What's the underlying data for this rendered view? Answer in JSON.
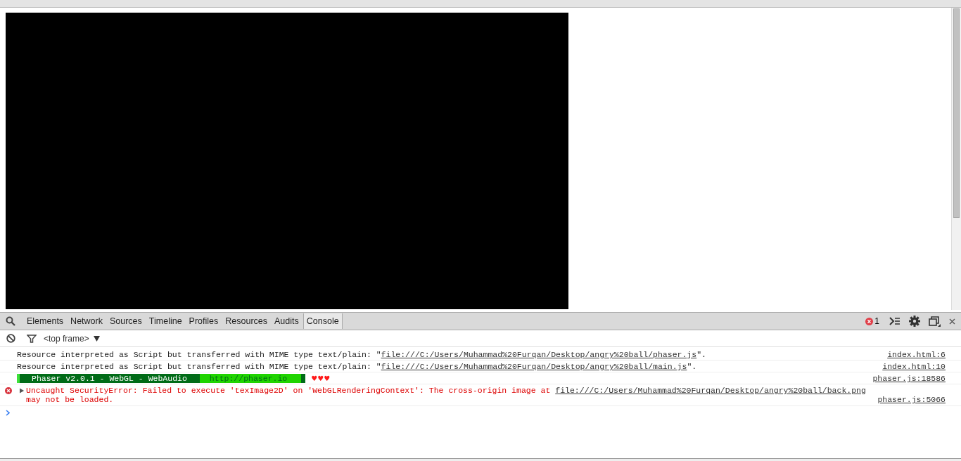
{
  "devtools": {
    "tabs": [
      {
        "label": "Elements",
        "selected": false
      },
      {
        "label": "Network",
        "selected": false
      },
      {
        "label": "Sources",
        "selected": false
      },
      {
        "label": "Timeline",
        "selected": false
      },
      {
        "label": "Profiles",
        "selected": false
      },
      {
        "label": "Resources",
        "selected": false
      },
      {
        "label": "Audits",
        "selected": false
      },
      {
        "label": "Console",
        "selected": true
      }
    ],
    "error_count": "1",
    "frame_selector": "<top frame>"
  },
  "console": {
    "messages": [
      {
        "kind": "log",
        "text": "Resource interpreted as Script but transferred with MIME type text/plain: \"",
        "link": "file:///C:/Users/Muhammad%20Furqan/Desktop/angry%20ball/phaser.js",
        "tail": "\".",
        "source": "index.html:6"
      },
      {
        "kind": "log",
        "text": "Resource interpreted as Script but transferred with MIME type text/plain: \"",
        "link": "file:///C:/Users/Muhammad%20Furqan/Desktop/angry%20ball/main.js",
        "tail": "\".",
        "source": "index.html:10"
      },
      {
        "kind": "banner",
        "title": "Phaser v2.0.1 - WebGL - WebAudio",
        "url": "http://phaser.io",
        "hearts": "♥♥♥",
        "source": "phaser.js:18586"
      },
      {
        "kind": "error",
        "expanded": false,
        "text": "Uncaught SecurityError: Failed to execute 'texImage2D' on 'WebGLRenderingContext': The cross-origin image at ",
        "link": "file:///C:/Users/Muhammad%20Furqan/Desktop/angry%20ball/back.png",
        "tail": " may not be loaded.",
        "source": "phaser.js:5066"
      }
    ]
  }
}
